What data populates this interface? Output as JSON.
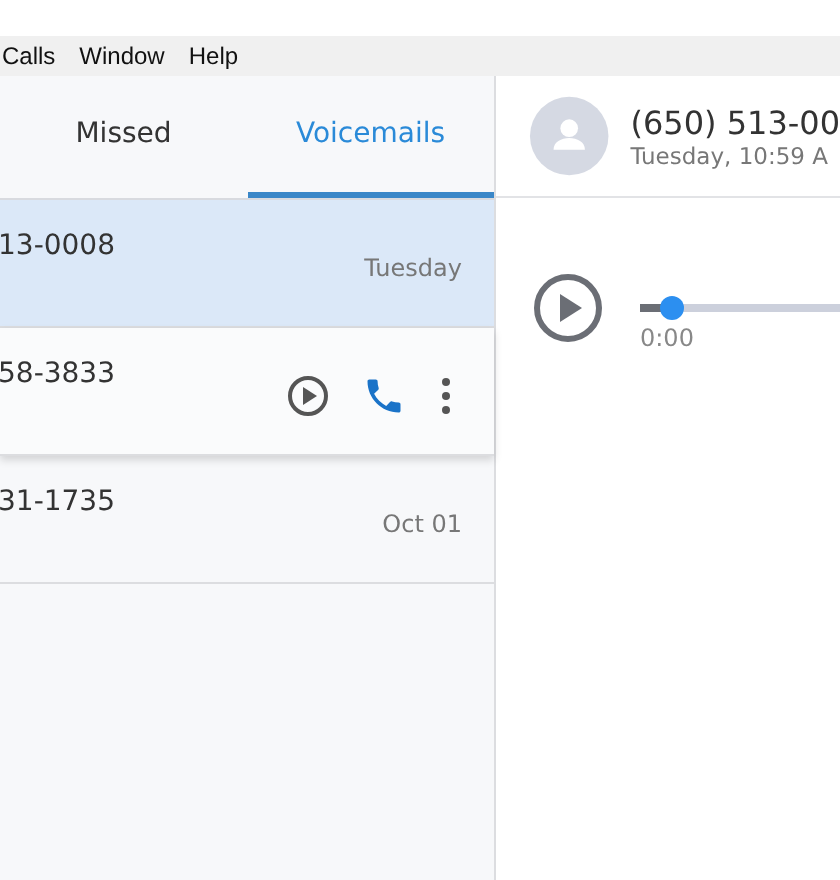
{
  "menu": [
    "Calls",
    "Window",
    "Help"
  ],
  "tabs": [
    {
      "label": "Missed",
      "selected": false
    },
    {
      "label": "Voicemails",
      "selected": true
    }
  ],
  "voicemails": [
    {
      "number": "13-0008",
      "date": "Tuesday",
      "selected": true,
      "hovered": false
    },
    {
      "number": "58-3833",
      "selected": false,
      "hovered": true
    },
    {
      "number": "31-1735",
      "date": "Oct 01",
      "selected": false,
      "hovered": false
    }
  ],
  "detail": {
    "caller": "(650) 513-00",
    "time": "Tuesday, 10:59 A"
  },
  "player": {
    "level": 0.16,
    "elapsed": "0:00"
  }
}
